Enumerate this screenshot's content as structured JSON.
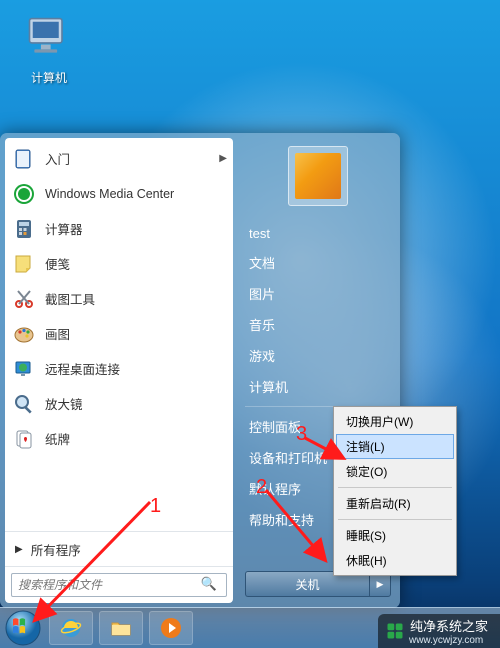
{
  "desktop": {
    "computer_label": "计算机"
  },
  "start_menu": {
    "pinned": [
      {
        "label": "入门",
        "icon": "book-icon",
        "submenu": true
      },
      {
        "label": "Windows Media Center",
        "icon": "wmc-icon",
        "submenu": false
      },
      {
        "label": "计算器",
        "icon": "calc-icon",
        "submenu": false
      },
      {
        "label": "便笺",
        "icon": "sticky-icon",
        "submenu": false
      },
      {
        "label": "截图工具",
        "icon": "snip-icon",
        "submenu": false
      },
      {
        "label": "画图",
        "icon": "paint-icon",
        "submenu": false
      },
      {
        "label": "远程桌面连接",
        "icon": "rdp-icon",
        "submenu": false
      },
      {
        "label": "放大镜",
        "icon": "magnify-icon",
        "submenu": false
      },
      {
        "label": "纸牌",
        "icon": "cards-icon",
        "submenu": false
      }
    ],
    "all_programs": "所有程序",
    "search_placeholder": "搜索程序和文件",
    "right": {
      "user_name": "test",
      "items_top": [
        "文档",
        "图片",
        "音乐",
        "游戏",
        "计算机"
      ],
      "items_bottom": [
        "控制面板",
        "设备和打印机",
        "默认程序",
        "帮助和支持"
      ]
    },
    "shutdown_label": "关机"
  },
  "power_menu": {
    "items": [
      "切换用户(W)",
      "注销(L)",
      "锁定(O)",
      "重新启动(R)",
      "睡眠(S)",
      "休眠(H)"
    ]
  },
  "annotations": {
    "n1": "1",
    "n2": "2",
    "n3": "3"
  },
  "watermark": {
    "title": "纯净系统之家",
    "url": "www.ycwjzy.com"
  }
}
